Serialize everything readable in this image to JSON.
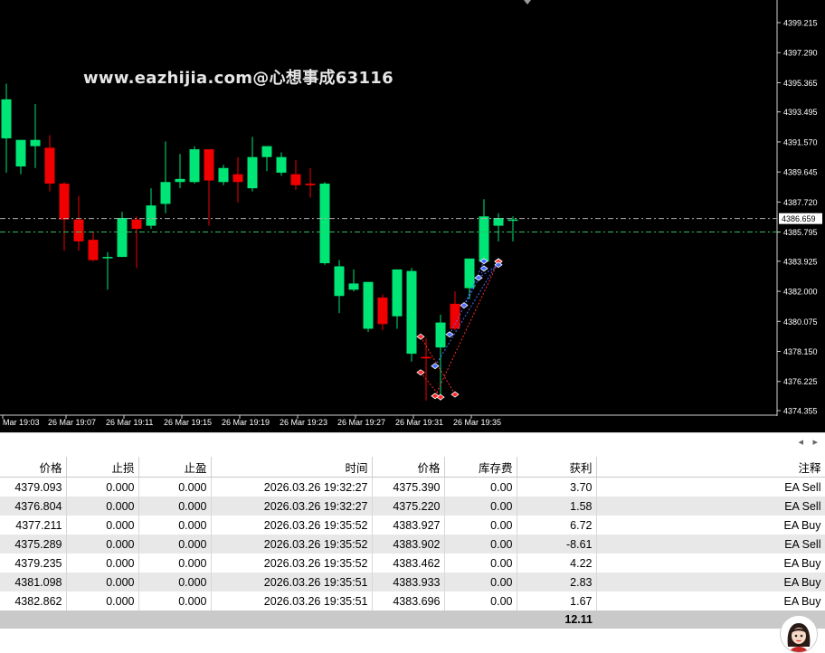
{
  "watermark": "www.eazhijia.com@心想事成63116",
  "colors": {
    "bull": "#00e676",
    "bear": "#f00000",
    "background": "#000000",
    "text": "#ffffff",
    "ask_line": "#2fbf5f"
  },
  "price_axis": {
    "labels": [
      "4399.215",
      "4397.290",
      "4395.365",
      "4393.495",
      "4391.570",
      "4389.645",
      "4387.720",
      "4385.795",
      "4383.925",
      "4382.000",
      "4380.075",
      "4378.150",
      "4376.225",
      "4374.355"
    ],
    "current_price": "4386.659"
  },
  "time_axis": [
    "Mar 19:03",
    "26 Mar 19:07",
    "26 Mar 19:11",
    "26 Mar 19:15",
    "26 Mar 19:19",
    "26 Mar 19:23",
    "26 Mar 19:27",
    "26 Mar 19:31",
    "26 Mar 19:35"
  ],
  "candles": [
    {
      "o": 4391.8,
      "h": 4395.3,
      "l": 4389.6,
      "c": 4394.3
    },
    {
      "o": 4390.0,
      "h": 4391.5,
      "l": 4389.5,
      "c": 4391.7
    },
    {
      "o": 4391.3,
      "h": 4394.0,
      "l": 4389.9,
      "c": 4391.7
    },
    {
      "o": 4391.2,
      "h": 4392.0,
      "l": 4388.4,
      "c": 4388.9
    },
    {
      "o": 4388.9,
      "h": 4389.0,
      "l": 4384.6,
      "c": 4386.6
    },
    {
      "o": 4386.6,
      "h": 4388.1,
      "l": 4384.6,
      "c": 4385.2
    },
    {
      "o": 4385.3,
      "h": 4385.8,
      "l": 4383.9,
      "c": 4384.0
    },
    {
      "o": 4384.2,
      "h": 4384.5,
      "l": 4382.1,
      "c": 4384.2
    },
    {
      "o": 4384.2,
      "h": 4387.1,
      "l": 4384.2,
      "c": 4386.7
    },
    {
      "o": 4386.6,
      "h": 4386.8,
      "l": 4383.5,
      "c": 4386.0
    },
    {
      "o": 4386.2,
      "h": 4388.6,
      "l": 4386.0,
      "c": 4387.5
    },
    {
      "o": 4387.6,
      "h": 4391.6,
      "l": 4387.0,
      "c": 4389.0
    },
    {
      "o": 4389.0,
      "h": 4390.8,
      "l": 4388.6,
      "c": 4389.2
    },
    {
      "o": 4389.0,
      "h": 4391.3,
      "l": 4388.9,
      "c": 4391.1
    },
    {
      "o": 4391.1,
      "h": 4391.1,
      "l": 4386.2,
      "c": 4389.1
    },
    {
      "o": 4389.0,
      "h": 4390.1,
      "l": 4388.8,
      "c": 4389.9
    },
    {
      "o": 4389.5,
      "h": 4390.6,
      "l": 4387.7,
      "c": 4389.0
    },
    {
      "o": 4388.6,
      "h": 4391.9,
      "l": 4388.4,
      "c": 4390.6
    },
    {
      "o": 4390.6,
      "h": 4390.9,
      "l": 4389.7,
      "c": 4391.3
    },
    {
      "o": 4389.6,
      "h": 4390.9,
      "l": 4389.4,
      "c": 4390.6
    },
    {
      "o": 4389.5,
      "h": 4390.4,
      "l": 4388.5,
      "c": 4388.8
    },
    {
      "o": 4388.9,
      "h": 4389.9,
      "l": 4388.0,
      "c": 4388.8
    },
    {
      "o": 4383.8,
      "h": 4389.0,
      "l": 4383.7,
      "c": 4388.9
    },
    {
      "o": 4381.7,
      "h": 4384.0,
      "l": 4380.6,
      "c": 4383.6
    },
    {
      "o": 4382.1,
      "h": 4383.4,
      "l": 4382.0,
      "c": 4382.5
    },
    {
      "o": 4379.6,
      "h": 4382.6,
      "l": 4379.4,
      "c": 4382.6
    },
    {
      "o": 4381.6,
      "h": 4381.8,
      "l": 4379.5,
      "c": 4379.9
    },
    {
      "o": 4380.4,
      "h": 4383.4,
      "l": 4379.6,
      "c": 4383.4
    },
    {
      "o": 4378.0,
      "h": 4383.5,
      "l": 4377.5,
      "c": 4383.3
    },
    {
      "o": 4377.8,
      "h": 4379.0,
      "l": 4375.0,
      "c": 4377.7
    },
    {
      "o": 4378.4,
      "h": 4380.5,
      "l": 4375.0,
      "c": 4380.0
    },
    {
      "o": 4381.2,
      "h": 4382.0,
      "l": 4379.5,
      "c": 4379.6
    },
    {
      "o": 4382.2,
      "h": 4384.0,
      "l": 4381.5,
      "c": 4384.1
    },
    {
      "o": 4383.9,
      "h": 4387.9,
      "l": 4383.9,
      "c": 4386.8
    },
    {
      "o": 4386.2,
      "h": 4387.0,
      "l": 4385.2,
      "c": 4386.7
    },
    {
      "o": 4386.6,
      "h": 4386.8,
      "l": 4385.2,
      "c": 4386.6
    }
  ],
  "table": {
    "headers": [
      "价格",
      "止损",
      "止盈",
      "时间",
      "价格",
      "库存费",
      "获利",
      "注释"
    ],
    "rows": [
      [
        "4379.093",
        "0.000",
        "0.000",
        "2026.03.26 19:32:27",
        "4375.390",
        "0.00",
        "3.70",
        "EA Sell"
      ],
      [
        "4376.804",
        "0.000",
        "0.000",
        "2026.03.26 19:32:27",
        "4375.220",
        "0.00",
        "1.58",
        "EA Sell"
      ],
      [
        "4377.211",
        "0.000",
        "0.000",
        "2026.03.26 19:35:52",
        "4383.927",
        "0.00",
        "6.72",
        "EA Buy"
      ],
      [
        "4375.289",
        "0.000",
        "0.000",
        "2026.03.26 19:35:52",
        "4383.902",
        "0.00",
        "-8.61",
        "EA Sell"
      ],
      [
        "4379.235",
        "0.000",
        "0.000",
        "2026.03.26 19:35:52",
        "4383.462",
        "0.00",
        "4.22",
        "EA Buy"
      ],
      [
        "4381.098",
        "0.000",
        "0.000",
        "2026.03.26 19:35:51",
        "4383.933",
        "0.00",
        "2.83",
        "EA Buy"
      ],
      [
        "4382.862",
        "0.000",
        "0.000",
        "2026.03.26 19:35:51",
        "4383.696",
        "0.00",
        "1.67",
        "EA Buy"
      ]
    ],
    "total": "12.11"
  }
}
